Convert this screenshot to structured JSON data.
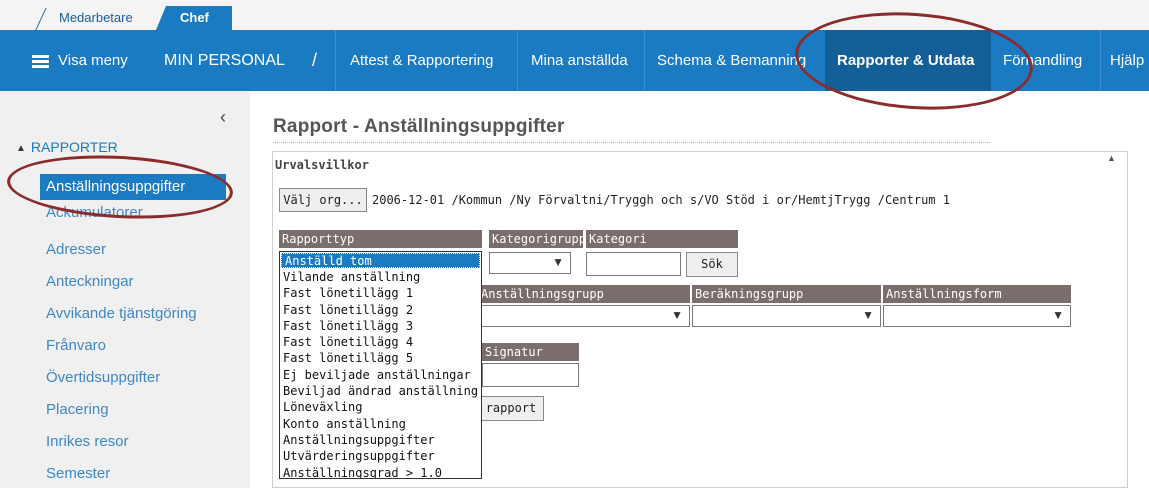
{
  "tabs": [
    {
      "label": "Medarbetare",
      "active": false
    },
    {
      "label": "Chef",
      "active": true
    }
  ],
  "navbar": {
    "menu_label": "Visa meny",
    "section": "MIN PERSONAL",
    "separator": "/",
    "items": [
      {
        "label": "Attest & Rapportering"
      },
      {
        "label": "Mina anställda"
      },
      {
        "label": "Schema & Bemanning"
      },
      {
        "label": "Rapporter & Utdata",
        "active": true
      },
      {
        "label": "Förhandling"
      },
      {
        "label": "Hjälp"
      }
    ]
  },
  "sidebar": {
    "collapse_glyph": "‹",
    "section_label": "RAPPORTER",
    "items": [
      {
        "label": "Anställningsuppgifter",
        "active": true
      },
      {
        "label": "Ackumulatorer"
      },
      {
        "label": "Adresser"
      },
      {
        "label": "Anteckningar"
      },
      {
        "label": "Avvikande tjänstgöring"
      },
      {
        "label": "Frånvaro"
      },
      {
        "label": "Övertidsuppgifter"
      },
      {
        "label": "Placering"
      },
      {
        "label": "Inrikes resor"
      },
      {
        "label": "Semester"
      }
    ]
  },
  "main": {
    "title": "Rapport - Anställningsuppgifter",
    "panel_title": "Urvalsvillkor",
    "valj_org_label": "Välj org...",
    "org_path": "2006-12-01 /Kommun /Ny Förvaltni/Tryggh och s/VO Stöd i or/HemtjTrygg /Centrum 1",
    "labels": {
      "rapporttyp": "Rapporttyp",
      "kategorigrupp": "Kategorigrupp",
      "kategori": "Kategori",
      "anstallningsgrupp": "Anställningsgrupp",
      "berakningsgrupp": "Beräkningsgrupp",
      "anstallningsform": "Anställningsform",
      "signatur": "Signatur"
    },
    "sok_label": "Sök",
    "rapport_label": "rapport",
    "rapporttyp_options": [
      "Anställd tom",
      "Vilande anställning",
      "Fast lönetillägg 1",
      "Fast lönetillägg 2",
      "Fast lönetillägg 3",
      "Fast lönetillägg 4",
      "Fast lönetillägg 5",
      "Ej beviljade anställningar",
      "Beviljad ändrad anställning",
      "Löneväxling",
      "Konto anställning",
      "Anställningsuppgifter",
      "Utvärderingsuppgifter",
      "Anställningsgrad > 1.0"
    ],
    "rapporttyp_selected": "Anställd tom"
  },
  "colors": {
    "nav_blue": "#1a7ac2",
    "nav_active": "#155f99",
    "header_brown": "#7a6e6c",
    "annotation_red": "#8b2b2b"
  }
}
